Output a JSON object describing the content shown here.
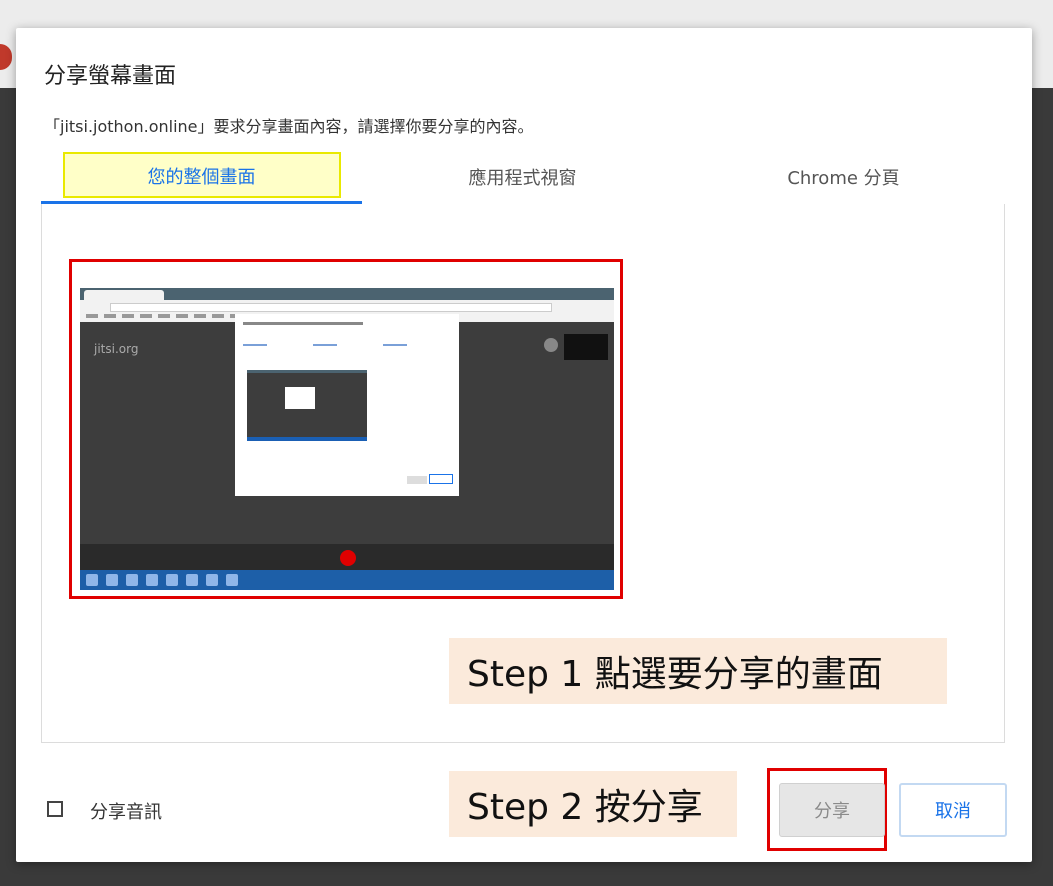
{
  "dialog": {
    "title": "分享螢幕畫面",
    "description": "「jitsi.jothon.online」要求分享畫面內容，請選擇你要分享的內容。"
  },
  "tabs": [
    {
      "label": "您的整個畫面",
      "selected": true
    },
    {
      "label": "應用程式視窗",
      "selected": false
    },
    {
      "label": "Chrome 分頁",
      "selected": false
    }
  ],
  "thumbnail": {
    "logo_text": "jitsi.org"
  },
  "annotations": {
    "step1": "Step 1 點選要分享的畫面",
    "step2": "Step 2 按分享"
  },
  "footer": {
    "audio_checkbox_label": "分享音訊",
    "audio_checked": false,
    "share_button": "分享",
    "cancel_button": "取消"
  },
  "colors": {
    "accent": "#1a73e8",
    "annotation_red": "#e00000",
    "tab_highlight": "#ffffc8",
    "step_label_bg": "#fbeadb"
  }
}
